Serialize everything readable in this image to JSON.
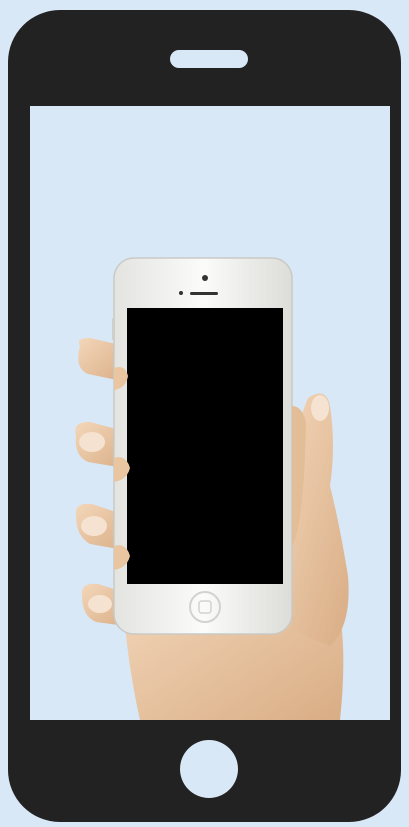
{
  "frame": {
    "frame_color": "#222222",
    "cutout_color": "#d9e8f7"
  },
  "photo": {
    "background_color": "#d9e8f7",
    "skin_color": "#ebc9a6",
    "device_body_color": "#f2f2f0",
    "device_screen_color": "#000000"
  }
}
